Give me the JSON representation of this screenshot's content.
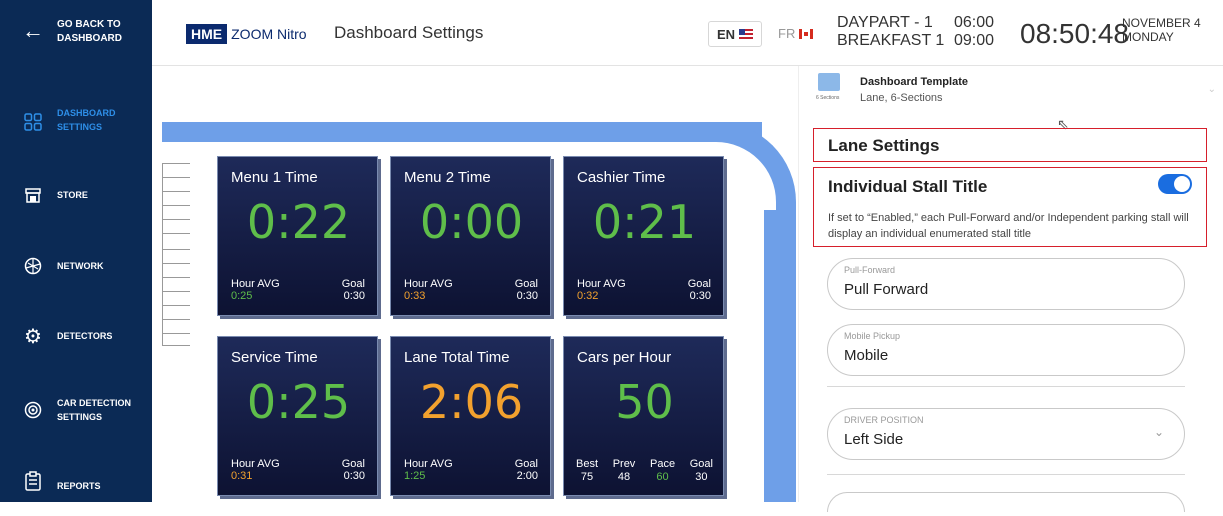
{
  "sidebar": {
    "back_label": "GO BACK TO DASHBOARD",
    "items": [
      {
        "label": "DASHBOARD SETTINGS",
        "icon": "dashboard-grid-icon"
      },
      {
        "label": "STORE",
        "icon": "store-icon"
      },
      {
        "label": "NETWORK",
        "icon": "network-icon"
      },
      {
        "label": "DETECTORS",
        "icon": "gear-icon"
      },
      {
        "label": "CAR DETECTION SETTINGS",
        "icon": "car-detection-icon"
      },
      {
        "label": "REPORTS",
        "icon": "clipboard-icon"
      }
    ]
  },
  "header": {
    "logo_hme": "HME",
    "logo_zoom": "ZOOM Nitro",
    "page_title": "Dashboard Settings",
    "lang_en": "EN",
    "lang_fr": "FR",
    "daypart_line1": "DAYPART - 1",
    "daypart_line2": "BREAKFAST 1",
    "daypart_start": "06:00",
    "daypart_end": "09:00",
    "clock": "08:50:48",
    "date_line1": "NOVEMBER 4",
    "date_line2": "MONDAY"
  },
  "tiles": [
    {
      "title": "Menu 1 Time",
      "value": "0:22",
      "avg_label": "Hour AVG",
      "avg": "0:25",
      "goal_label": "Goal",
      "goal": "0:30"
    },
    {
      "title": "Menu 2 Time",
      "value": "0:00",
      "avg_label": "Hour AVG",
      "avg": "0:33",
      "goal_label": "Goal",
      "goal": "0:30"
    },
    {
      "title": "Cashier Time",
      "value": "0:21",
      "avg_label": "Hour AVG",
      "avg": "0:32",
      "goal_label": "Goal",
      "goal": "0:30"
    },
    {
      "title": "Service Time",
      "value": "0:25",
      "avg_label": "Hour AVG",
      "avg": "0:31",
      "goal_label": "Goal",
      "goal": "0:30"
    },
    {
      "title": "Lane Total Time",
      "value": "2:06",
      "avg_label": "Hour AVG",
      "avg": "1:25",
      "goal_label": "Goal",
      "goal": "2:00"
    },
    {
      "title": "Cars per Hour",
      "value": "50",
      "best_label": "Best",
      "best": "75",
      "prev_label": "Prev",
      "prev": "48",
      "pace_label": "Pace",
      "pace": "60",
      "goal_label": "Goal",
      "goal": "30"
    }
  ],
  "panel": {
    "template_icon_caption": "6 Sections",
    "template_title": "Dashboard Template",
    "template_sub": "Lane, 6-Sections",
    "lane_settings": "Lane Settings",
    "stall_title": "Individual Stall Title",
    "stall_enabled": true,
    "stall_desc": "If set to “Enabled,” each Pull-Forward and/or Independent parking stall will display an individual enumerated stall title",
    "fields": [
      {
        "label": "Pull-Forward",
        "value": "Pull Forward"
      },
      {
        "label": "Mobile Pickup",
        "value": "Mobile"
      },
      {
        "label": "DRIVER POSITION",
        "value": "Left Side"
      }
    ]
  },
  "colors": {
    "sidebar": "#0b2a55",
    "accent": "#2e8fe8",
    "lane": "#6e9fe8",
    "good": "#5fbe4a",
    "warn": "#f2a12e",
    "highlight": "#d61f2b"
  }
}
